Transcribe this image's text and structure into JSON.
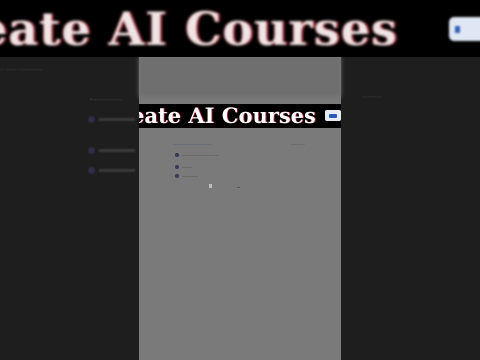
{
  "banner": {
    "title": "eate AI Courses"
  },
  "caption": {
    "text": "eate AI Courses"
  },
  "background": {
    "breadcrumb": "—  ———  ——————",
    "card_title": "•  ———————",
    "right_title": "—————"
  },
  "panel": {
    "title": "———————————",
    "link": "————",
    "rows": [
      "———————————",
      "———",
      "—————"
    ]
  },
  "colors": {
    "banner_text": "#f1e4e4",
    "caption_text": "#ffffff",
    "accent_red": "#9b1c2a",
    "badge_blue": "#2a5bb0",
    "center_gray": "#7a7a7a"
  }
}
